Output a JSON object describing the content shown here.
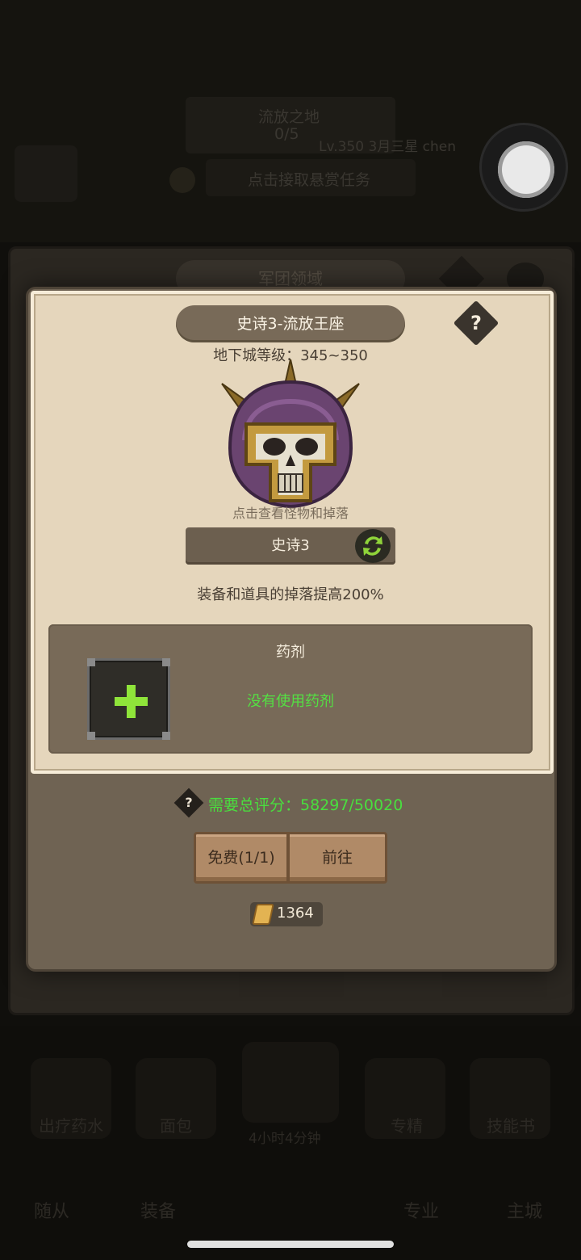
{
  "background": {
    "zone_name": "流放之地",
    "zone_progress": "0/5",
    "player_info": "Lv.350 3月三星 chen",
    "task_hint": "点击接取悬赏任务",
    "outer_panel_title": "军团领域",
    "bottom_labels": [
      "出疗药水",
      "面包",
      "4小时4分钟",
      "专精",
      "技能书"
    ],
    "nav_tabs": [
      "随从",
      "装备",
      "专业",
      "主城"
    ]
  },
  "dialog": {
    "title": "史诗3-流放王座",
    "help_symbol": "?",
    "dungeon_level": "地下城等级：345~350",
    "boss_hint": "点击查看怪物和掉落",
    "difficulty": "史诗3",
    "drop_bonus": "装备和道具的掉落提高200%",
    "potion": {
      "title": "药剂",
      "status": "没有使用药剂"
    },
    "score_help_symbol": "?",
    "score_requirement": "需要总评分：58297/50020",
    "buttons": {
      "free": "免费(1/1)",
      "go": "前往"
    },
    "currency_amount": "1364"
  },
  "colors": {
    "parchment": "#e5d6bc",
    "panel": "#6f6353",
    "accent_green": "#49df3e",
    "button": "#b08a67"
  }
}
